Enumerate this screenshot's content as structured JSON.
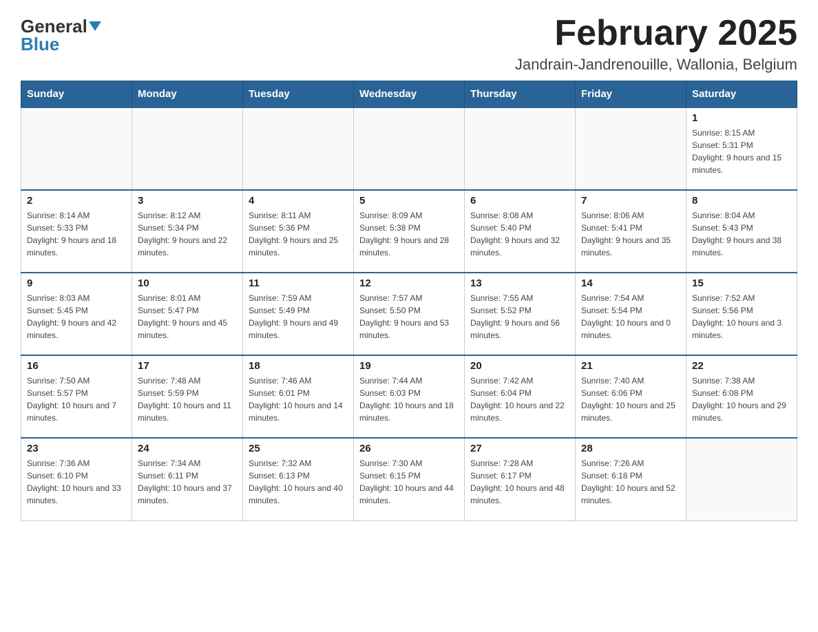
{
  "header": {
    "logo": {
      "part1": "General",
      "part2": "Blue"
    },
    "title": "February 2025",
    "location": "Jandrain-Jandrenouille, Wallonia, Belgium"
  },
  "weekdays": [
    "Sunday",
    "Monday",
    "Tuesday",
    "Wednesday",
    "Thursday",
    "Friday",
    "Saturday"
  ],
  "weeks": [
    [
      {
        "day": "",
        "info": ""
      },
      {
        "day": "",
        "info": ""
      },
      {
        "day": "",
        "info": ""
      },
      {
        "day": "",
        "info": ""
      },
      {
        "day": "",
        "info": ""
      },
      {
        "day": "",
        "info": ""
      },
      {
        "day": "1",
        "info": "Sunrise: 8:15 AM\nSunset: 5:31 PM\nDaylight: 9 hours and 15 minutes."
      }
    ],
    [
      {
        "day": "2",
        "info": "Sunrise: 8:14 AM\nSunset: 5:33 PM\nDaylight: 9 hours and 18 minutes."
      },
      {
        "day": "3",
        "info": "Sunrise: 8:12 AM\nSunset: 5:34 PM\nDaylight: 9 hours and 22 minutes."
      },
      {
        "day": "4",
        "info": "Sunrise: 8:11 AM\nSunset: 5:36 PM\nDaylight: 9 hours and 25 minutes."
      },
      {
        "day": "5",
        "info": "Sunrise: 8:09 AM\nSunset: 5:38 PM\nDaylight: 9 hours and 28 minutes."
      },
      {
        "day": "6",
        "info": "Sunrise: 8:08 AM\nSunset: 5:40 PM\nDaylight: 9 hours and 32 minutes."
      },
      {
        "day": "7",
        "info": "Sunrise: 8:06 AM\nSunset: 5:41 PM\nDaylight: 9 hours and 35 minutes."
      },
      {
        "day": "8",
        "info": "Sunrise: 8:04 AM\nSunset: 5:43 PM\nDaylight: 9 hours and 38 minutes."
      }
    ],
    [
      {
        "day": "9",
        "info": "Sunrise: 8:03 AM\nSunset: 5:45 PM\nDaylight: 9 hours and 42 minutes."
      },
      {
        "day": "10",
        "info": "Sunrise: 8:01 AM\nSunset: 5:47 PM\nDaylight: 9 hours and 45 minutes."
      },
      {
        "day": "11",
        "info": "Sunrise: 7:59 AM\nSunset: 5:49 PM\nDaylight: 9 hours and 49 minutes."
      },
      {
        "day": "12",
        "info": "Sunrise: 7:57 AM\nSunset: 5:50 PM\nDaylight: 9 hours and 53 minutes."
      },
      {
        "day": "13",
        "info": "Sunrise: 7:55 AM\nSunset: 5:52 PM\nDaylight: 9 hours and 56 minutes."
      },
      {
        "day": "14",
        "info": "Sunrise: 7:54 AM\nSunset: 5:54 PM\nDaylight: 10 hours and 0 minutes."
      },
      {
        "day": "15",
        "info": "Sunrise: 7:52 AM\nSunset: 5:56 PM\nDaylight: 10 hours and 3 minutes."
      }
    ],
    [
      {
        "day": "16",
        "info": "Sunrise: 7:50 AM\nSunset: 5:57 PM\nDaylight: 10 hours and 7 minutes."
      },
      {
        "day": "17",
        "info": "Sunrise: 7:48 AM\nSunset: 5:59 PM\nDaylight: 10 hours and 11 minutes."
      },
      {
        "day": "18",
        "info": "Sunrise: 7:46 AM\nSunset: 6:01 PM\nDaylight: 10 hours and 14 minutes."
      },
      {
        "day": "19",
        "info": "Sunrise: 7:44 AM\nSunset: 6:03 PM\nDaylight: 10 hours and 18 minutes."
      },
      {
        "day": "20",
        "info": "Sunrise: 7:42 AM\nSunset: 6:04 PM\nDaylight: 10 hours and 22 minutes."
      },
      {
        "day": "21",
        "info": "Sunrise: 7:40 AM\nSunset: 6:06 PM\nDaylight: 10 hours and 25 minutes."
      },
      {
        "day": "22",
        "info": "Sunrise: 7:38 AM\nSunset: 6:08 PM\nDaylight: 10 hours and 29 minutes."
      }
    ],
    [
      {
        "day": "23",
        "info": "Sunrise: 7:36 AM\nSunset: 6:10 PM\nDaylight: 10 hours and 33 minutes."
      },
      {
        "day": "24",
        "info": "Sunrise: 7:34 AM\nSunset: 6:11 PM\nDaylight: 10 hours and 37 minutes."
      },
      {
        "day": "25",
        "info": "Sunrise: 7:32 AM\nSunset: 6:13 PM\nDaylight: 10 hours and 40 minutes."
      },
      {
        "day": "26",
        "info": "Sunrise: 7:30 AM\nSunset: 6:15 PM\nDaylight: 10 hours and 44 minutes."
      },
      {
        "day": "27",
        "info": "Sunrise: 7:28 AM\nSunset: 6:17 PM\nDaylight: 10 hours and 48 minutes."
      },
      {
        "day": "28",
        "info": "Sunrise: 7:26 AM\nSunset: 6:18 PM\nDaylight: 10 hours and 52 minutes."
      },
      {
        "day": "",
        "info": ""
      }
    ]
  ]
}
